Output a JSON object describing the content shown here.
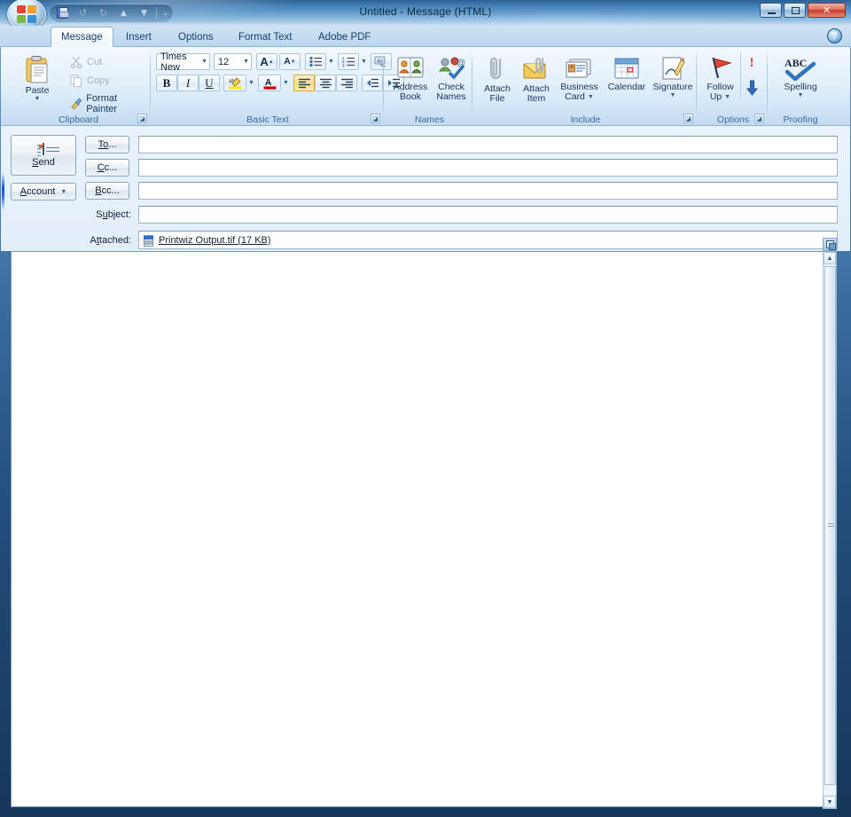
{
  "window": {
    "title": "Untitled - Message (HTML)",
    "minimize_label": "Minimize",
    "maximize_label": "Maximize",
    "close_label": "✕"
  },
  "quick_access": {
    "save_label": "Save",
    "undo_label": "Undo",
    "redo_label": "Redo",
    "previous_label": "Previous Item",
    "next_label": "Next Item",
    "customize_label": "⌄"
  },
  "office_button": {
    "label": "Office Button"
  },
  "help_button": {
    "label": "?"
  },
  "tabs": [
    {
      "label": "Message",
      "active": true
    },
    {
      "label": "Insert",
      "active": false
    },
    {
      "label": "Options",
      "active": false
    },
    {
      "label": "Format Text",
      "active": false
    },
    {
      "label": "Adobe PDF",
      "active": false
    }
  ],
  "ribbon": {
    "groups": [
      {
        "name": "Clipboard",
        "label": "Clipboard",
        "paste_label": "Paste",
        "cut_label": "Cut",
        "copy_label": "Copy",
        "format_painter_label": "Format Painter",
        "launcher_label": "Clipboard dialog launcher"
      },
      {
        "name": "Basic Text",
        "label": "Basic Text",
        "font_name": "Times New",
        "font_size": "12",
        "grow_font_label": "A",
        "shrink_font_label": "A",
        "bullets_label": "Bullets",
        "numbering_label": "Numbering",
        "clear_formatting_label": "Aa",
        "bold_label": "B",
        "italic_label": "I",
        "underline_label": "U",
        "highlight_label": "ab",
        "font_color_label": "A",
        "align_left_label": "Align Left",
        "align_center_label": "Center",
        "align_right_label": "Align Right",
        "decrease_indent_label": "Decrease Indent",
        "increase_indent_label": "Increase Indent",
        "launcher_label": "Basic Text dialog launcher"
      },
      {
        "name": "Names",
        "label": "Names",
        "address_book_label": "Address\nBook",
        "address_book_line1": "Address",
        "address_book_line2": "Book",
        "check_names_line1": "Check",
        "check_names_line2": "Names"
      },
      {
        "name": "Include",
        "label": "Include",
        "attach_file_line1": "Attach",
        "attach_file_line2": "File",
        "attach_item_line1": "Attach",
        "attach_item_line2": "Item",
        "business_card_line1": "Business",
        "business_card_line2": "Card",
        "calendar_label": "Calendar",
        "signature_label": "Signature",
        "launcher_label": "Include dialog launcher"
      },
      {
        "name": "Options",
        "label": "Options",
        "follow_up_line1": "Follow",
        "follow_up_line2": "Up",
        "high_importance_label": "!",
        "low_importance_label": "Low Importance",
        "launcher_label": "Options dialog launcher"
      },
      {
        "name": "Proofing",
        "label": "Proofing",
        "spelling_label": "Spelling",
        "spelling_icon_label": "ABC"
      }
    ]
  },
  "compose": {
    "send_label": "Send",
    "send_accel": "S",
    "send_rest": "end",
    "account_label": "Account",
    "account_accel": "A",
    "account_rest": "ccount",
    "to_accel": "To",
    "to_rest": "...",
    "cc_accel": "C",
    "cc_rest": "c...",
    "bcc_accel": "B",
    "bcc_rest": "cc...",
    "subject_accel": "u",
    "subject_pre": "S",
    "subject_post": "bject:",
    "attached_pre": "A",
    "attached_accel": "t",
    "attached_post": "tached:",
    "to_value": "",
    "cc_value": "",
    "bcc_value": "",
    "subject_value": "",
    "attachment": {
      "name": "Printwiz Output.tif (17 KB)",
      "icon": "tif-file-icon"
    }
  },
  "body": {
    "content": "",
    "scroll_up_label": "▲",
    "scroll_down_label": "▼",
    "options_label": "Message options"
  },
  "colors": {
    "accent": "#15406e",
    "title_bar": "#4a7fb5",
    "ribbon_bg": "#e3effa",
    "highlight_yellow": "#ffd700",
    "font_color_red": "#cc0000",
    "close_red": "#c23a28"
  }
}
